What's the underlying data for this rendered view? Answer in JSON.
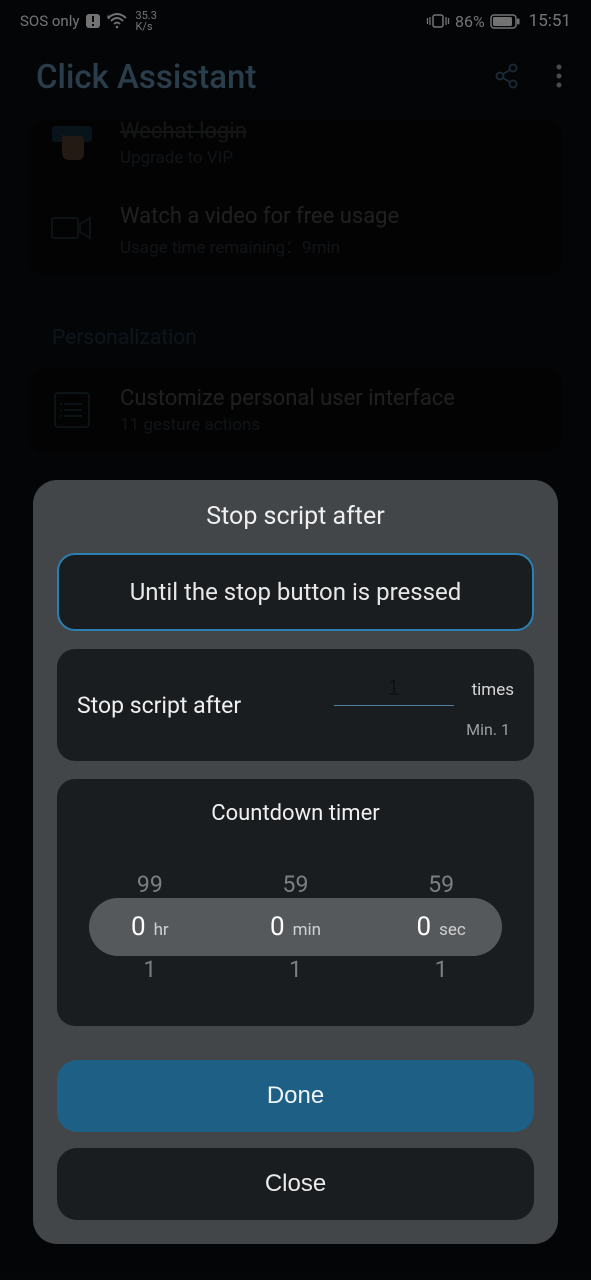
{
  "status": {
    "sos": "SOS only",
    "net_value": "35.3",
    "net_unit": "K/s",
    "battery": "86%",
    "time": "15:51"
  },
  "header": {
    "title": "Click Assistant"
  },
  "bg": {
    "item1_title": "Wechat login",
    "item1_sub": "Upgrade to VIP",
    "item2_title": "Watch a video for free usage",
    "item2_sub": "Usage time remaining：9min",
    "section": "Personalization",
    "item3_title": "Customize personal user interface",
    "item3_sub": "11 gesture actions"
  },
  "dialog": {
    "title": "Stop script after",
    "opt_until": "Until the stop button is pressed",
    "stop_after_label": "Stop script after",
    "times_value": "1",
    "times_unit": "times",
    "min_hint": "Min. 1",
    "countdown_label": "Countdown timer",
    "hr": {
      "above": "99",
      "value": "0",
      "unit": "hr",
      "below": "1"
    },
    "min": {
      "above": "59",
      "value": "0",
      "unit": "min",
      "below": "1"
    },
    "sec": {
      "above": "59",
      "value": "0",
      "unit": "sec",
      "below": "1"
    },
    "done": "Done",
    "close": "Close"
  }
}
